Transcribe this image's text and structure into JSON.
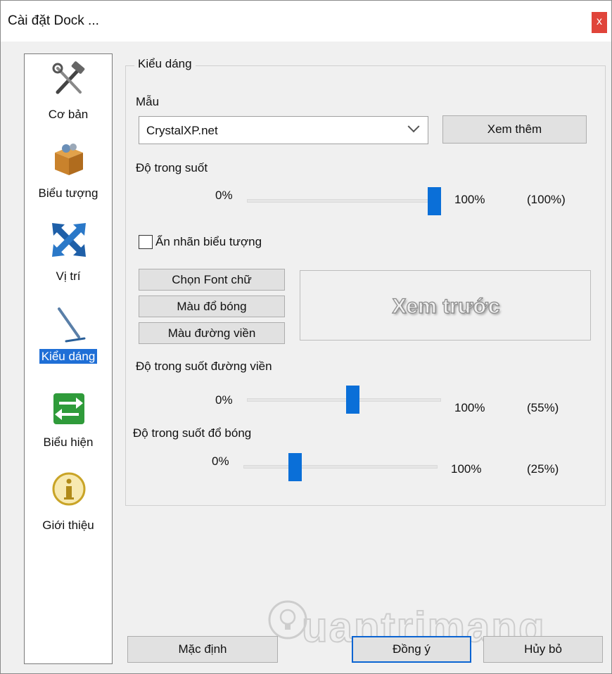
{
  "window": {
    "title": "Cài đặt Dock ...",
    "close_label": "x"
  },
  "sidebar": {
    "items": [
      {
        "label": "Cơ bản",
        "icon": "tools-icon"
      },
      {
        "label": "Biểu tượng",
        "icon": "box-icon"
      },
      {
        "label": "Vị trí",
        "icon": "arrows-cross-icon"
      },
      {
        "label": "Kiểu dáng",
        "icon": "pen-icon",
        "selected": true
      },
      {
        "label": "Biểu hiện",
        "icon": "swap-arrows-icon"
      },
      {
        "label": "Giới thiệu",
        "icon": "info-icon"
      }
    ]
  },
  "style": {
    "group_title": "Kiểu dáng",
    "template_label": "Mẫu",
    "template_value": "CrystalXP.net",
    "more_button": "Xem thêm",
    "transparency": {
      "label": "Độ trong suốt",
      "min": "0%",
      "max": "100%",
      "value_text": "(100%)",
      "value": 100
    },
    "hide_labels": {
      "label": "Ẩn nhãn biểu tượng",
      "checked": false
    },
    "font_button": "Chọn Font chữ",
    "shadow_color_button": "Màu đổ bóng",
    "border_color_button": "Màu đường viền",
    "preview_text": "Xem trước",
    "border_transparency": {
      "label": "Độ trong suốt đường viền",
      "min": "0%",
      "max": "100%",
      "value_text": "(55%)",
      "value": 55
    },
    "shadow_transparency": {
      "label": "Độ trong suốt đổ bóng",
      "min": "0%",
      "max": "100%",
      "value_text": "(25%)",
      "value": 25
    }
  },
  "footer": {
    "default_button": "Mặc định",
    "ok_button": "Đồng ý",
    "cancel_button": "Hủy bỏ"
  },
  "watermark": {
    "text": "uantrimang"
  },
  "colors": {
    "accent": "#0a6fd8",
    "selection": "#1f6fd6",
    "close": "#e0443a"
  }
}
